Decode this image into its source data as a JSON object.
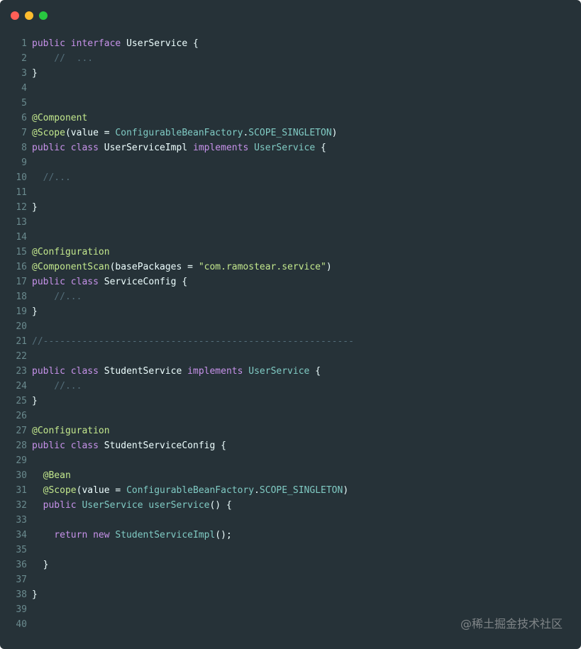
{
  "window": {
    "controls": {
      "close_color": "#ff5f57",
      "minimize_color": "#febc2e",
      "maximize_color": "#28c840"
    }
  },
  "colors": {
    "background": "#263238",
    "keyword": "#c792ea",
    "type": "#80cbc4",
    "annotation": "#c3e88d",
    "comment": "#546e7a",
    "plain": "#eeffff",
    "line_number": "#6a8a8e"
  },
  "code": {
    "lines": [
      {
        "n": "1",
        "tokens": [
          {
            "t": "public ",
            "c": "kw"
          },
          {
            "t": "interface ",
            "c": "kw"
          },
          {
            "t": "UserService ",
            "c": "pl"
          },
          {
            "t": "{",
            "c": "pl"
          }
        ]
      },
      {
        "n": "2",
        "tokens": [
          {
            "t": "    //  ...",
            "c": "cm"
          }
        ]
      },
      {
        "n": "3",
        "tokens": [
          {
            "t": "}",
            "c": "pl"
          }
        ]
      },
      {
        "n": "4",
        "tokens": []
      },
      {
        "n": "5",
        "tokens": []
      },
      {
        "n": "6",
        "tokens": [
          {
            "t": "@Component",
            "c": "an"
          }
        ]
      },
      {
        "n": "7",
        "tokens": [
          {
            "t": "@Scope",
            "c": "an"
          },
          {
            "t": "(",
            "c": "pl"
          },
          {
            "t": "value",
            "c": "pl"
          },
          {
            "t": " = ",
            "c": "pl"
          },
          {
            "t": "ConfigurableBeanFactory",
            "c": "ty"
          },
          {
            "t": ".",
            "c": "pl"
          },
          {
            "t": "SCOPE_SINGLETON",
            "c": "ty"
          },
          {
            "t": ")",
            "c": "pl"
          }
        ]
      },
      {
        "n": "8",
        "tokens": [
          {
            "t": "public ",
            "c": "kw"
          },
          {
            "t": "class ",
            "c": "kw"
          },
          {
            "t": "UserServiceImpl ",
            "c": "pl"
          },
          {
            "t": "implements ",
            "c": "kw"
          },
          {
            "t": "UserService ",
            "c": "ty"
          },
          {
            "t": "{",
            "c": "pl"
          }
        ]
      },
      {
        "n": "9",
        "tokens": []
      },
      {
        "n": "10",
        "tokens": [
          {
            "t": "  //...",
            "c": "cm"
          }
        ]
      },
      {
        "n": "11",
        "tokens": []
      },
      {
        "n": "12",
        "tokens": [
          {
            "t": "}",
            "c": "pl"
          }
        ]
      },
      {
        "n": "13",
        "tokens": []
      },
      {
        "n": "14",
        "tokens": []
      },
      {
        "n": "15",
        "tokens": [
          {
            "t": "@Configuration",
            "c": "an"
          }
        ]
      },
      {
        "n": "16",
        "tokens": [
          {
            "t": "@ComponentScan",
            "c": "an"
          },
          {
            "t": "(",
            "c": "pl"
          },
          {
            "t": "basePackages",
            "c": "pl"
          },
          {
            "t": " = ",
            "c": "pl"
          },
          {
            "t": "\"com.ramostear.service\"",
            "c": "st"
          },
          {
            "t": ")",
            "c": "pl"
          }
        ]
      },
      {
        "n": "17",
        "tokens": [
          {
            "t": "public ",
            "c": "kw"
          },
          {
            "t": "class ",
            "c": "kw"
          },
          {
            "t": "ServiceConfig ",
            "c": "pl"
          },
          {
            "t": "{",
            "c": "pl"
          }
        ]
      },
      {
        "n": "18",
        "tokens": [
          {
            "t": "    //...",
            "c": "cm"
          }
        ]
      },
      {
        "n": "19",
        "tokens": [
          {
            "t": "}",
            "c": "pl"
          }
        ]
      },
      {
        "n": "20",
        "tokens": []
      },
      {
        "n": "21",
        "tokens": [
          {
            "t": "//--------------------------------------------------------",
            "c": "cm"
          }
        ]
      },
      {
        "n": "22",
        "tokens": []
      },
      {
        "n": "23",
        "tokens": [
          {
            "t": "public ",
            "c": "kw"
          },
          {
            "t": "class ",
            "c": "kw"
          },
          {
            "t": "StudentService ",
            "c": "pl"
          },
          {
            "t": "implements ",
            "c": "kw"
          },
          {
            "t": "UserService ",
            "c": "ty"
          },
          {
            "t": "{",
            "c": "pl"
          }
        ]
      },
      {
        "n": "24",
        "tokens": [
          {
            "t": "    //...",
            "c": "cm"
          }
        ]
      },
      {
        "n": "25",
        "tokens": [
          {
            "t": "}",
            "c": "pl"
          }
        ]
      },
      {
        "n": "26",
        "tokens": []
      },
      {
        "n": "27",
        "tokens": [
          {
            "t": "@Configuration",
            "c": "an"
          }
        ]
      },
      {
        "n": "28",
        "tokens": [
          {
            "t": "public ",
            "c": "kw"
          },
          {
            "t": "class ",
            "c": "kw"
          },
          {
            "t": "StudentServiceConfig ",
            "c": "pl"
          },
          {
            "t": "{",
            "c": "pl"
          }
        ]
      },
      {
        "n": "29",
        "tokens": []
      },
      {
        "n": "30",
        "tokens": [
          {
            "t": "  @Bean",
            "c": "an"
          }
        ]
      },
      {
        "n": "31",
        "tokens": [
          {
            "t": "  @Scope",
            "c": "an"
          },
          {
            "t": "(",
            "c": "pl"
          },
          {
            "t": "value",
            "c": "pl"
          },
          {
            "t": " = ",
            "c": "pl"
          },
          {
            "t": "ConfigurableBeanFactory",
            "c": "ty"
          },
          {
            "t": ".",
            "c": "pl"
          },
          {
            "t": "SCOPE_SINGLETON",
            "c": "ty"
          },
          {
            "t": ")",
            "c": "pl"
          }
        ]
      },
      {
        "n": "32",
        "tokens": [
          {
            "t": "  public ",
            "c": "kw"
          },
          {
            "t": "UserService ",
            "c": "ty"
          },
          {
            "t": "userService",
            "c": "ty"
          },
          {
            "t": "() {",
            "c": "pl"
          }
        ]
      },
      {
        "n": "33",
        "tokens": []
      },
      {
        "n": "34",
        "tokens": [
          {
            "t": "    return ",
            "c": "kw"
          },
          {
            "t": "new ",
            "c": "kw"
          },
          {
            "t": "StudentServiceImpl",
            "c": "ty"
          },
          {
            "t": "();",
            "c": "pl"
          }
        ]
      },
      {
        "n": "35",
        "tokens": []
      },
      {
        "n": "36",
        "tokens": [
          {
            "t": "  }",
            "c": "pl"
          }
        ]
      },
      {
        "n": "37",
        "tokens": []
      },
      {
        "n": "38",
        "tokens": [
          {
            "t": "}",
            "c": "pl"
          }
        ]
      },
      {
        "n": "39",
        "tokens": []
      },
      {
        "n": "40",
        "tokens": []
      }
    ]
  },
  "watermark": {
    "text": "@稀土掘金技术社区"
  }
}
